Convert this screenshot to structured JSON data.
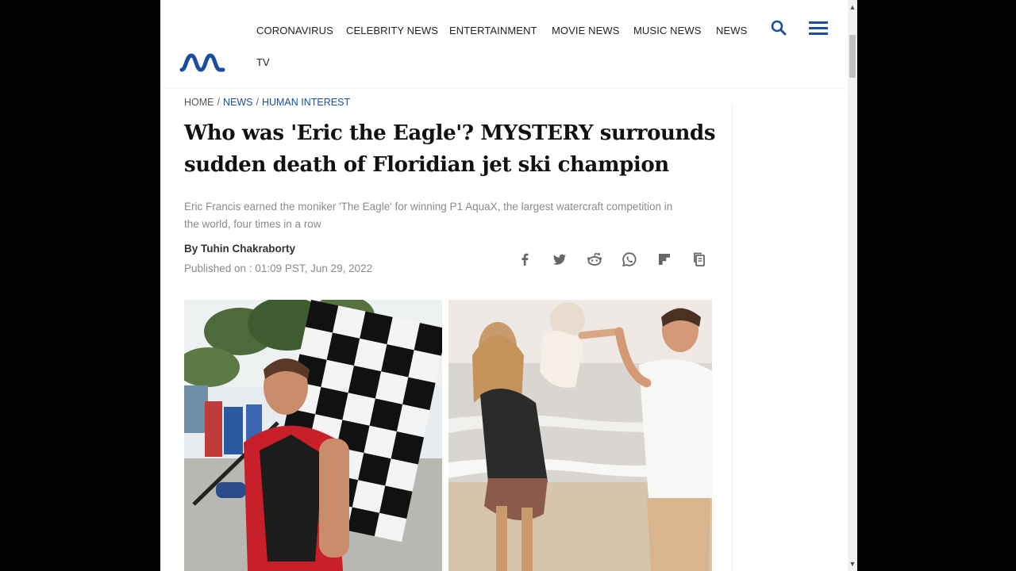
{
  "nav": {
    "items": [
      {
        "label": "CORONAVIRUS"
      },
      {
        "label": "CELEBRITY NEWS"
      },
      {
        "label": "ENTERTAINMENT"
      },
      {
        "label": "MOVIE NEWS"
      },
      {
        "label": "MUSIC NEWS"
      },
      {
        "label": "NEWS"
      },
      {
        "label": "TV"
      }
    ]
  },
  "breadcrumb": {
    "home": "HOME",
    "sep": "/",
    "news": "NEWS",
    "category": "HUMAN INTEREST"
  },
  "article": {
    "title": "Who was 'Eric the Eagle'? MYSTERY surrounds sudden death of Floridian jet ski champion",
    "summary": "Eric Francis earned the moniker 'The Eagle' for winning P1 AquaX, the largest watercraft competition in the world, four times in a row",
    "byline_prefix": "By",
    "author": "Tuhin Chakraborty",
    "published": "Published on : 01:09 PST, Jun 29, 2022"
  },
  "share": {
    "icons": [
      "facebook-icon",
      "twitter-icon",
      "reddit-icon",
      "whatsapp-icon",
      "flipboard-icon",
      "copy-link-icon"
    ]
  },
  "colors": {
    "brand": "#1a4fa0",
    "text": "#111111",
    "muted": "#8a8a8a"
  }
}
